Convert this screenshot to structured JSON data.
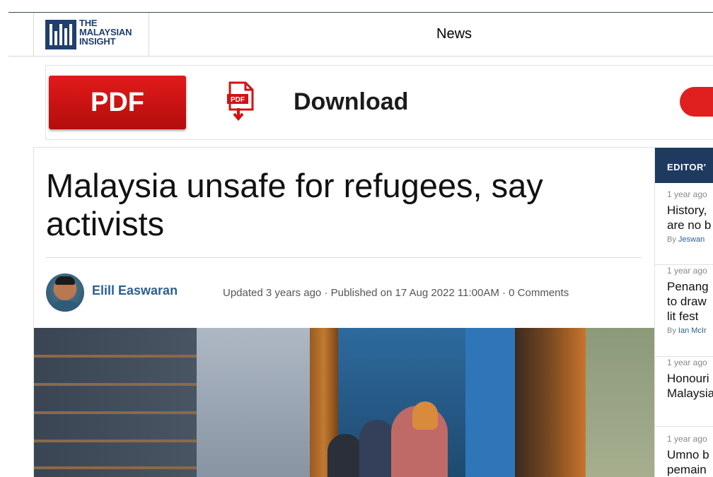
{
  "header": {
    "logo_lines": [
      "THE",
      "MALAYSIAN",
      "INSIGHT"
    ],
    "nav_label": "News"
  },
  "ad": {
    "button_label": "PDF",
    "icon_label": "PDF",
    "text": "Download",
    "colors": {
      "red": "#d11313"
    }
  },
  "article": {
    "title": "Malaysia unsafe for refugees, say activists",
    "author": "Elill Easwaran",
    "meta": "Updated 3 years ago · Published on 17 Aug 2022 11:00AM · 0 Comments"
  },
  "sidebar": {
    "heading": "EDITOR'",
    "items": [
      {
        "time": "1 year ago",
        "lines": [
          "History,",
          "are no b"
        ],
        "by_prefix": "By",
        "by_name": "Jeswan"
      },
      {
        "time": "1 year ago",
        "lines": [
          "Penang",
          "to draw",
          "lit fest"
        ],
        "by_prefix": "By",
        "by_name": "Ian McIr"
      },
      {
        "time": "1 year ago",
        "lines": [
          "Honouri",
          "Malaysia"
        ],
        "by_prefix": "",
        "by_name": ""
      },
      {
        "time": "1 year ago",
        "lines": [
          "Umno b",
          "pemain"
        ],
        "by_prefix": "",
        "by_name": ""
      }
    ]
  },
  "colors": {
    "brand_navy": "#1e3a5f",
    "link_blue": "#2c5f8f"
  }
}
